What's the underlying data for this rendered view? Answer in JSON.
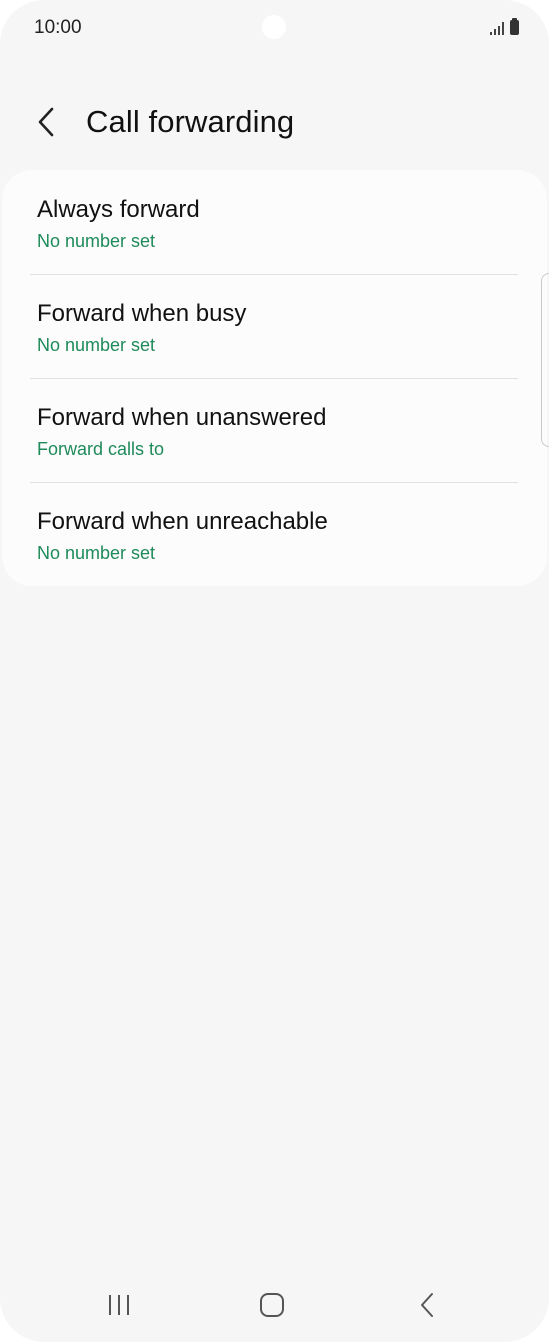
{
  "status_bar": {
    "time": "10:00"
  },
  "header": {
    "title": "Call forwarding"
  },
  "items": [
    {
      "title": "Always forward",
      "subtitle": "No number set"
    },
    {
      "title": "Forward when busy",
      "subtitle": "No number set"
    },
    {
      "title": "Forward when unanswered",
      "subtitle": "Forward calls to"
    },
    {
      "title": "Forward when unreachable",
      "subtitle": "No number set"
    }
  ],
  "colors": {
    "accent": "#1f8a5a",
    "background": "#f6f6f6",
    "card": "#fcfcfc"
  },
  "icons": {
    "back": "chevron-left-icon",
    "recents": "recents-icon",
    "home": "home-icon",
    "nav_back": "back-icon"
  }
}
